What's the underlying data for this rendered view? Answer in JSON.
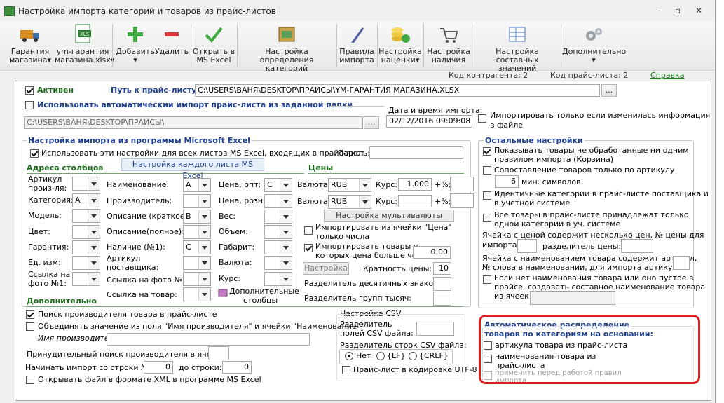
{
  "window": {
    "title": "Настройка импорта категорий и товаров из прайс-листов",
    "min": "–",
    "max": "▫",
    "close": "✕"
  },
  "toolbar": {
    "items": [
      {
        "label1": "Гарантия",
        "label2": "магазина▾"
      },
      {
        "label1": "ym-гарантия",
        "label2": "магазина.xlsx▾"
      },
      {
        "label1": "Добавить",
        "label2": "▾"
      },
      {
        "label1": "Удалить",
        "label2": ""
      },
      {
        "label1": "Открыть в",
        "label2": "MS Excel"
      },
      {
        "label1": "Настройка определения",
        "label2": "категорий"
      },
      {
        "label1": "Правила",
        "label2": "импорта"
      },
      {
        "label1": "Настройка",
        "label2": "наценки▾"
      },
      {
        "label1": "Настройка",
        "label2": "наличия"
      },
      {
        "label1": "Настройка составных",
        "label2": "значений"
      },
      {
        "label1": "Дополнительно",
        "label2": "▾"
      }
    ],
    "xls_badge": "XLS"
  },
  "status": {
    "contractor_code": "Код контрагента: 2",
    "pricelist_code": "Код прайс-листа: 2",
    "help": "Справка"
  },
  "top": {
    "active": "Активен",
    "path_label": "Путь к прайс-листу:",
    "path_value": "C:\\USERS\\ВАНЯ\\DESKTOP\\ПРАЙСЫ\\YM-ГАРАНТИЯ МАГАЗИНА.XLSX",
    "browse": "...",
    "auto_import": "Использовать автоматический импорт прайс-листа из заданной папки",
    "folder_value": "C:\\USERS\\ВАНЯ\\DESKTOP\\ПРАЙСЫ\\",
    "datetime_label": "Дата и время импорта:",
    "datetime_value": "02/12/2016 09:09:08",
    "only_changed": "Импортировать только если изменилась информация",
    "only_changed2": "в файле"
  },
  "excel": {
    "title": "Настройка импорта из программы Microsoft Excel",
    "use_all": "Использовать эти настройки для всех листов MS Excel, входящих в прайс-лист",
    "password": "Пароль:",
    "col_addr": "Адреса столбцов",
    "each_sheet": "Настройка каждого листа MS Excel",
    "prices": "Цены",
    "article": "Артикул",
    "article2": "произ-ля:",
    "category": "Категория:",
    "category_val": "A",
    "model": "Модель:",
    "color": "Цвет:",
    "warranty": "Гарантия:",
    "unit": "Ед. изм:",
    "photo_link": "Ссылка на",
    "photo_link2": "фото №1:",
    "name": "Наименование:",
    "name_val": "A",
    "producer": "Производитель:",
    "desc_short": "Описание (краткое):",
    "desc_short_val": "B",
    "desc_full": "Описание(полное):",
    "avail": "Наличие (№1):",
    "avail_val": "C",
    "supp_art": "Артикул",
    "supp_art2": "поставщика:",
    "photo2": "Ссылка на фото №2:",
    "prod_link": "Ссылка на товар:",
    "price_opt": "Цена, опт:",
    "price_opt_val": "C",
    "price_retail": "Цена, розн.:",
    "weight": "Вес:",
    "volume": "Объем:",
    "size": "Габарит:",
    "currency": "Валюта:",
    "rate_col": "Курс:",
    "extra_cols": "Дополнительные",
    "extra_cols2": "столбцы",
    "val_label": "Валюта:",
    "val1": "RUB",
    "val2": "RUB",
    "rate_label": "Курс:",
    "rate1": "1.000",
    "plus_pct": "+%:",
    "multicurrency": "Настройка мультивалюты",
    "numbers_only": "Импортировать из ячейки \"Цена\"",
    "numbers_only2": "только числа",
    "price_gt": "Импортировать товары у",
    "price_gt2": "которых цена больше чем:",
    "price_gt_val": "0.00",
    "setting": "Настройка",
    "multiplicity": "Кратность цены:",
    "multiplicity_val": "10",
    "dec_sep": "Разделитель десятичных знаков:",
    "grp_sep": "Разделитель групп тысяч:"
  },
  "additional": {
    "title": "Дополнительно",
    "find_producer": "Поиск производителя товара в прайс-листе",
    "merge": "Объединять значение из поля \"Имя производителя\" и ячейки \"Наименование\"",
    "producer_name": "Имя производителя:",
    "force_search": "Принудительный поиск производителя в ячейке:",
    "start_row": "Начинать импорт со строки №:",
    "start_row_val": "0",
    "to_row": "до строки:",
    "to_row_val": "0",
    "open_xml": "Открывать файл в формате XML в программе MS Excel"
  },
  "csv": {
    "title": "Настройка CSV",
    "field_sep": "Разделитель",
    "field_sep2": "полей CSV файла:",
    "row_sep": "Разделитель строк CSV файла:",
    "no": "Нет",
    "lf": "{LF}",
    "crlf": "{CRLF}",
    "utf8": "Прайс-лист в кодировке UTF-8"
  },
  "other": {
    "title": "Остальные настройки",
    "show_unprocessed": "Показывать товары не обработанные ни одним",
    "show_unprocessed2": "правилом импорта (Корзина)",
    "match_article": "Сопоставление товаров только по артикулу",
    "min_symbols_val": "6",
    "min_symbols": "мин. символов",
    "identical": "Идентичные категории в прайс-листе поставщика и",
    "identical2": "в учетной системе",
    "all_one_cat": "Все товары в прайс-листе принадлежат только",
    "all_one_cat2": "одной категории в уч. системе",
    "multi_price": "Ячейка с ценой содержит несколько цен, № цены для",
    "multi_price2": "импорта:",
    "price_sep": "разделитель цены:",
    "name_contains": "Ячейка с наименованием товара содержит артикул,",
    "name_contains2": "№ слова в наименовании, для импорта артикула:",
    "no_name": "Если нет наименования товара или оно пустое в",
    "no_name2": "прайсе, создавать составное наименование товара",
    "no_name3": "из ячеек:"
  },
  "auto_dist": {
    "title": "Автоматическое распределение",
    "title2": "товаров по категориям на основании:",
    "by_article": "артикула товара из прайс-листа",
    "by_name": "наименования товара из",
    "by_name2": "прайс-листа",
    "apply": "применить перед работой правил",
    "apply2": "импорта"
  },
  "colors": {
    "accent_green": "#1a6a1a",
    "accent_blue": "#1f3f8f",
    "highlight": "#e02020"
  }
}
